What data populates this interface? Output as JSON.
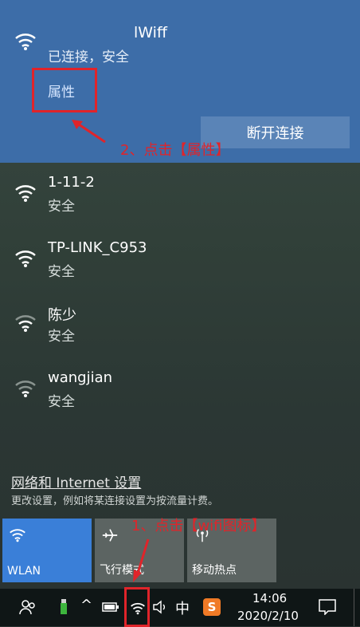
{
  "selected_network": {
    "name": "lWiff",
    "status": "已连接，安全",
    "properties_label": "属性",
    "disconnect_label": "断开连接"
  },
  "networks": [
    {
      "name": "1-11-2",
      "status": "安全"
    },
    {
      "name": "TP-LINK_C953",
      "status": "安全"
    },
    {
      "name": "陈少",
      "status": "安全"
    },
    {
      "name": "wangjian",
      "status": "安全"
    }
  ],
  "annotations": {
    "step1": "1、点击【wifi图标】",
    "step2": "2、点击【属性】",
    "color": "#e0242a"
  },
  "settings": {
    "link": "网络和 Internet 设置",
    "description": "更改设置，例如将某连接设置为按流量计费。"
  },
  "quick_actions": [
    {
      "label": "WLAN",
      "icon": "wifi-icon",
      "active": true
    },
    {
      "label": "飞行模式",
      "icon": "airplane-icon",
      "active": false
    },
    {
      "label": "移动热点",
      "icon": "hotspot-icon",
      "active": false
    }
  ],
  "taskbar": {
    "ime": "中",
    "time": "14:06",
    "date": "2020/2/10"
  },
  "colors": {
    "accent": "#3d6da8",
    "tile_active": "#3a7fd8"
  }
}
